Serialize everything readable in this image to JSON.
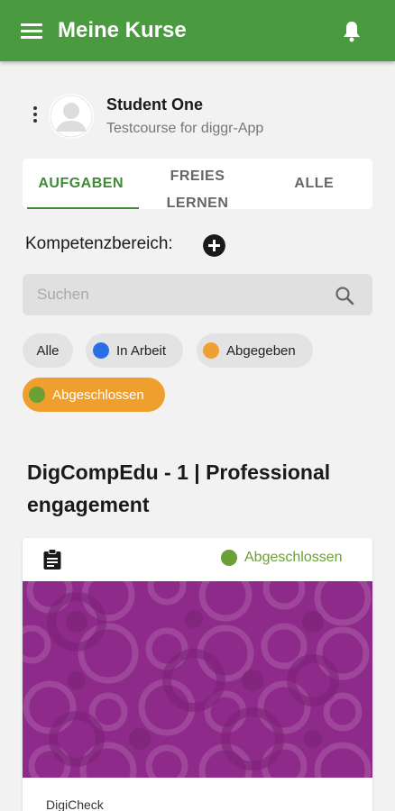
{
  "appbar": {
    "title": "Meine Kurse"
  },
  "user": {
    "name": "Student One",
    "course": "Testcourse for diggr-App"
  },
  "tabs": [
    {
      "line1": "AUFGABEN",
      "line2": ""
    },
    {
      "line1": "FREIES",
      "line2": "LERNEN"
    },
    {
      "line1": "ALLE",
      "line2": ""
    }
  ],
  "active_tab": 0,
  "filter": {
    "label": "Kompetenzbereich:"
  },
  "search": {
    "placeholder": "Suchen",
    "value": ""
  },
  "chips": {
    "alle": {
      "label": "Alle"
    },
    "in_arbeit": {
      "label": "In Arbeit",
      "color": "#2a6fe8"
    },
    "abgegeben": {
      "label": "Abgegeben",
      "color": "#f0a030"
    },
    "abgeschlossen": {
      "label": "Abgeschlossen",
      "color": "#6aa036",
      "selected": true
    }
  },
  "section": {
    "title": "DigCompEdu - 1 | Professional engagement"
  },
  "card": {
    "status": "Abgeschlossen",
    "status_color": "#6aa036",
    "label": "DigiCheck",
    "image_color": "#8e2a89"
  },
  "colors": {
    "primary": "#4a9a3f",
    "accent": "#ef9f2e"
  }
}
